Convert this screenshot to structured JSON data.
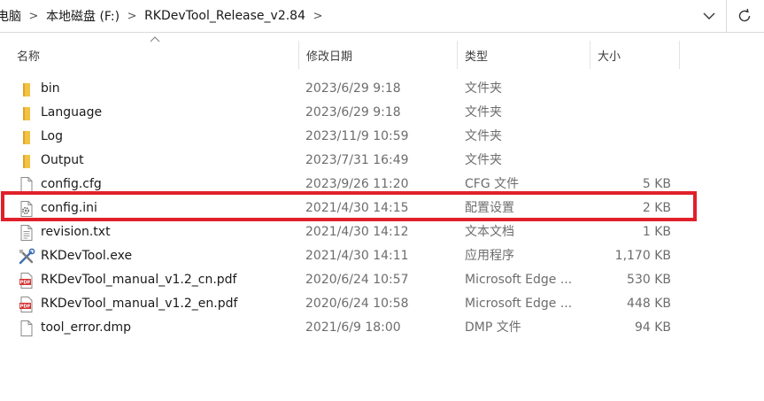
{
  "address_bar": {
    "crumbs": [
      "电脑",
      "本地磁盘 (F:)",
      "RKDevTool_Release_v2.84"
    ],
    "separator": ">",
    "dropdown_icon": "chevron-down-icon",
    "refresh_icon": "refresh-icon"
  },
  "columns": {
    "name": "名称",
    "date": "修改日期",
    "type": "类型",
    "size": "大小"
  },
  "colors": {
    "highlight": "#e0202a",
    "folder": "#f4c242",
    "pdf": "#d32f2f"
  },
  "files": [
    {
      "name": "bin",
      "date": "2023/6/29 9:18",
      "type": "文件夹",
      "size": "",
      "icon": "folder-icon"
    },
    {
      "name": "Language",
      "date": "2023/6/29 9:18",
      "type": "文件夹",
      "size": "",
      "icon": "folder-icon"
    },
    {
      "name": "Log",
      "date": "2023/11/9 10:59",
      "type": "文件夹",
      "size": "",
      "icon": "folder-icon"
    },
    {
      "name": "Output",
      "date": "2023/7/31 16:49",
      "type": "文件夹",
      "size": "",
      "icon": "folder-icon"
    },
    {
      "name": "config.cfg",
      "date": "2023/9/26 11:20",
      "type": "CFG 文件",
      "size": "5 KB",
      "icon": "file-icon"
    },
    {
      "name": "config.ini",
      "date": "2021/4/30 14:15",
      "type": "配置设置",
      "size": "2 KB",
      "icon": "settings-file-icon",
      "highlighted": true
    },
    {
      "name": "revision.txt",
      "date": "2021/4/30 14:12",
      "type": "文本文档",
      "size": "1 KB",
      "icon": "text-file-icon"
    },
    {
      "name": "RKDevTool.exe",
      "date": "2021/4/30 14:11",
      "type": "应用程序",
      "size": "1,170 KB",
      "icon": "tools-icon"
    },
    {
      "name": "RKDevTool_manual_v1.2_cn.pdf",
      "date": "2020/6/24 10:57",
      "type": "Microsoft Edge ...",
      "size": "530 KB",
      "icon": "pdf-icon"
    },
    {
      "name": "RKDevTool_manual_v1.2_en.pdf",
      "date": "2020/6/24 10:58",
      "type": "Microsoft Edge ...",
      "size": "448 KB",
      "icon": "pdf-icon"
    },
    {
      "name": "tool_error.dmp",
      "date": "2021/6/9 18:00",
      "type": "DMP 文件",
      "size": "94 KB",
      "icon": "file-icon"
    }
  ]
}
